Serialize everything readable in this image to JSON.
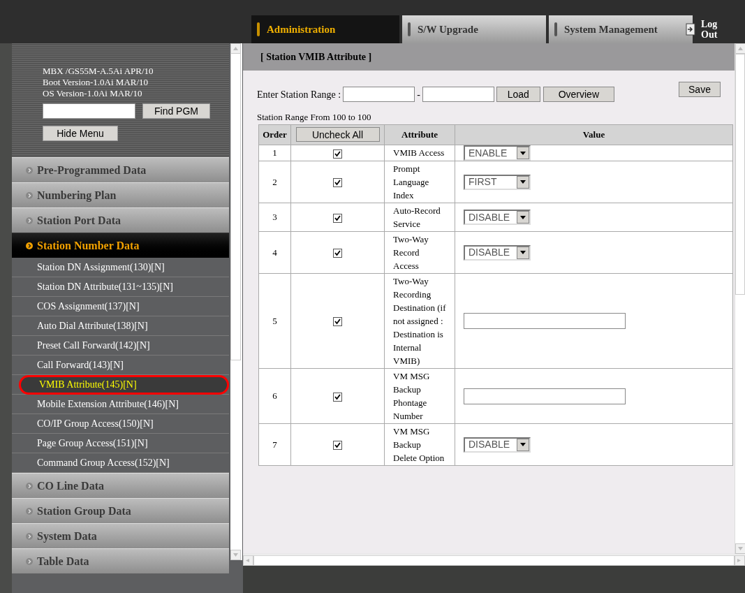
{
  "tabs": [
    {
      "label": "Administration",
      "selected": true
    },
    {
      "label": "S/W Upgrade",
      "selected": false
    },
    {
      "label": "System Management",
      "selected": false
    }
  ],
  "logout": "Log Out",
  "sidebar": {
    "info": [
      "MBX /GS55M-A.5Ai APR/10",
      "Boot Version-1.0Ai MAR/10",
      "OS Version-1.0Ai MAR/10"
    ],
    "find_button": "Find PGM",
    "hide_button": "Hide Menu",
    "sections": [
      {
        "label": "Pre-Programmed Data",
        "expanded": false
      },
      {
        "label": "Numbering Plan",
        "expanded": false
      },
      {
        "label": "Station Port Data",
        "expanded": false
      },
      {
        "label": "Station Number Data",
        "expanded": true,
        "children": [
          {
            "label": "Station DN Assignment(130)[N]",
            "selected": false
          },
          {
            "label": "Station DN Attribute(131~135)[N]",
            "selected": false
          },
          {
            "label": "COS Assignment(137)[N]",
            "selected": false
          },
          {
            "label": "Auto Dial Attribute(138)[N]",
            "selected": false
          },
          {
            "label": "Preset Call Forward(142)[N]",
            "selected": false
          },
          {
            "label": "Call Forward(143)[N]",
            "selected": false
          },
          {
            "label": "VMIB Attribute(145)[N]",
            "selected": true
          },
          {
            "label": "Mobile Extension Attribute(146)[N]",
            "selected": false
          },
          {
            "label": "CO/IP Group Access(150)[N]",
            "selected": false
          },
          {
            "label": "Page Group Access(151)[N]",
            "selected": false
          },
          {
            "label": "Command Group Access(152)[N]",
            "selected": false
          }
        ]
      },
      {
        "label": "CO Line Data",
        "expanded": false
      },
      {
        "label": "Station Group Data",
        "expanded": false
      },
      {
        "label": "System Data",
        "expanded": false
      },
      {
        "label": "Table Data",
        "expanded": false
      }
    ]
  },
  "main": {
    "title": "[ Station VMIB Attribute ]",
    "range_label": "Enter Station Range :",
    "range_separator": "-",
    "load_button": "Load",
    "overview_button": "Overview",
    "save_button": "Save",
    "range_info": "Station Range From 100 to 100",
    "table": {
      "columns": [
        "Order",
        "Uncheck All",
        "Attribute",
        "Value"
      ],
      "rows": [
        {
          "order": "1",
          "checked": true,
          "attribute": "VMIB Access",
          "kind": "select",
          "value": "ENABLE"
        },
        {
          "order": "2",
          "checked": true,
          "attribute": "Prompt Language Index",
          "kind": "select",
          "value": "FIRST"
        },
        {
          "order": "3",
          "checked": true,
          "attribute": "Auto-Record Service",
          "kind": "select",
          "value": "DISABLE"
        },
        {
          "order": "4",
          "checked": true,
          "attribute": "Two-Way Record Access",
          "kind": "select",
          "value": "DISABLE"
        },
        {
          "order": "5",
          "checked": true,
          "attribute": "Two-Way Recording Destination (if not assigned : Destination is Internal VMIB)",
          "kind": "text"
        },
        {
          "order": "6",
          "checked": true,
          "attribute": "VM MSG Backup Phontage Number",
          "kind": "text"
        },
        {
          "order": "7",
          "checked": true,
          "attribute": "VM MSG Backup Delete Option",
          "kind": "select",
          "value": "DISABLE"
        }
      ]
    }
  }
}
